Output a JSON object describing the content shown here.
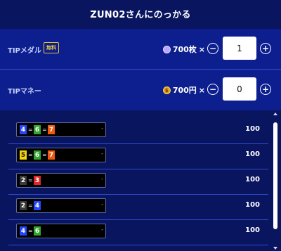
{
  "header": {
    "title": "ZUN02さんにのっかる"
  },
  "tip_medal": {
    "label": "TIPメダル",
    "badge": "無料",
    "price": "700枚",
    "times": "×",
    "minus": "−",
    "plus": "+",
    "quantity": "1",
    "coin_icon": "medal-coin-icon"
  },
  "tip_money": {
    "label": "TIPマネー",
    "price": "700円",
    "times": "×",
    "minus": "−",
    "plus": "+",
    "quantity": "0",
    "coin_icon": "yen-coin-icon"
  },
  "list": [
    {
      "nums": [
        "4",
        "6",
        "7"
      ],
      "colors": [
        "n-blue",
        "n-green",
        "n-orange"
      ],
      "dash": "-",
      "amount": "100"
    },
    {
      "nums": [
        "5",
        "6",
        "7"
      ],
      "colors": [
        "n-yellow",
        "n-green",
        "n-orange"
      ],
      "dash": "-",
      "amount": "100"
    },
    {
      "nums": [
        "2",
        "3"
      ],
      "colors": [
        "n-gray",
        "n-red"
      ],
      "dash": "-",
      "amount": "100"
    },
    {
      "nums": [
        "2",
        "4"
      ],
      "colors": [
        "n-gray",
        "n-blue"
      ],
      "dash": "-",
      "amount": "100"
    },
    {
      "nums": [
        "4",
        "6"
      ],
      "colors": [
        "n-blue",
        "n-green"
      ],
      "dash": "-",
      "amount": "100"
    }
  ],
  "eq_sign": "=",
  "colors": {
    "background": "#0a1560",
    "row_background": "#0d1f8f",
    "badge": "#e8c537"
  }
}
